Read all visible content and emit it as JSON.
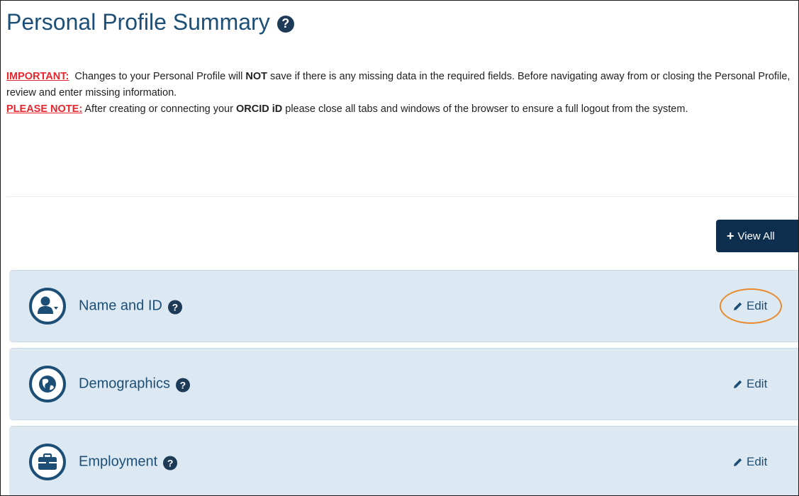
{
  "page": {
    "title": "Personal Profile Summary",
    "title_help_icon": "question-circle-icon"
  },
  "notice": {
    "important_label": "IMPORTANT:",
    "important_part1": "Changes to your Personal Profile will",
    "important_bold": "NOT",
    "important_part2": "save if there is any missing data in the required fields. Before navigating away from or closing the Personal Profile, review and enter missing information.",
    "please_note_label": "PLEASE NOTE:",
    "note_part1": "After creating or connecting your",
    "note_bold": "ORCID iD",
    "note_part2": "please close all tabs and windows of the browser to ensure a full logout from the system."
  },
  "toolbar": {
    "view_all_label": "View All",
    "view_all_icon": "plus-icon"
  },
  "sections": [
    {
      "title": "Name and ID",
      "icon": "user-icon",
      "edit_label": "Edit",
      "edit_icon": "pencil-icon",
      "highlighted": true
    },
    {
      "title": "Demographics",
      "icon": "globe-icon",
      "edit_label": "Edit",
      "edit_icon": "pencil-icon",
      "highlighted": false
    },
    {
      "title": "Employment",
      "icon": "briefcase-icon",
      "edit_label": "Edit",
      "edit_icon": "pencil-icon",
      "highlighted": false
    }
  ],
  "help_glyph": "?",
  "plus_glyph": "+",
  "colors": {
    "title_blue": "#1d4f76",
    "red_label": "#e8242c",
    "button_navy": "#0e2e4e",
    "section_bg": "#dce8f2",
    "highlight_orange": "#e98a2e"
  }
}
